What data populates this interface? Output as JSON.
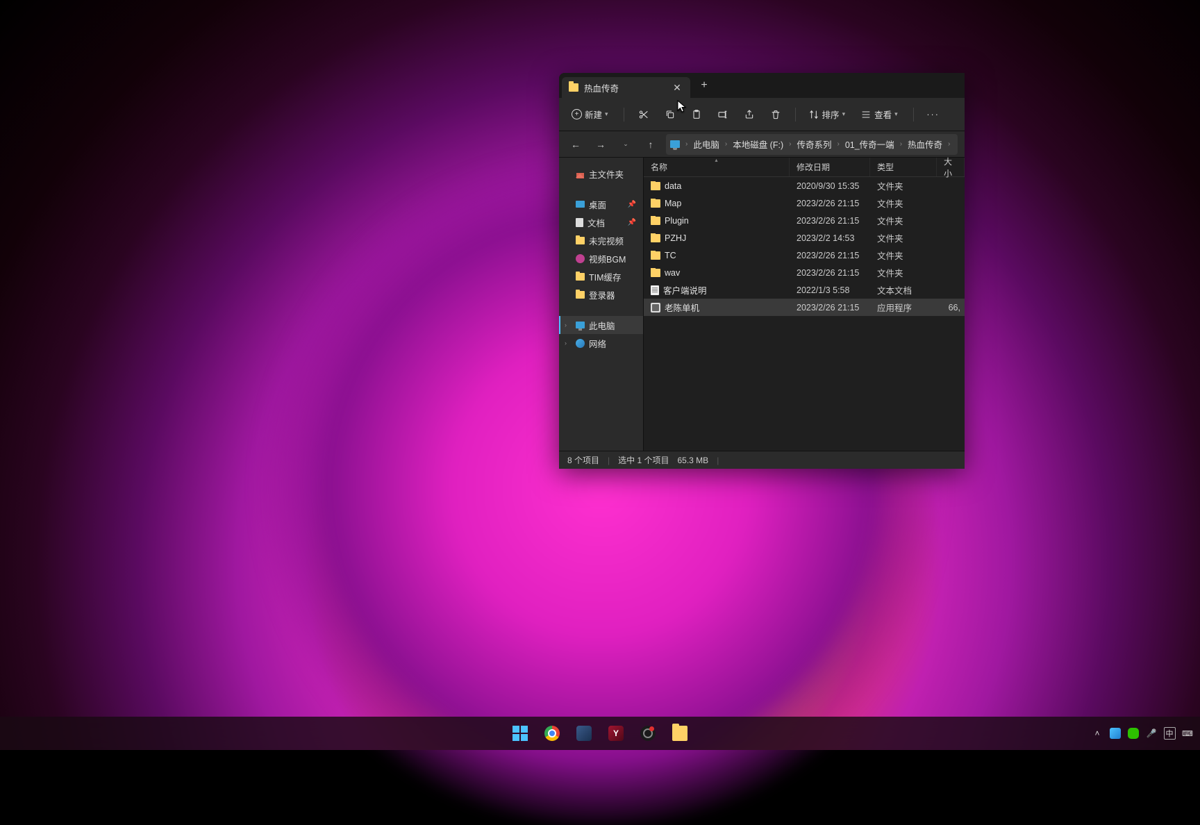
{
  "tab": {
    "title": "热血传奇"
  },
  "toolbar": {
    "new_label": "新建",
    "sort_label": "排序",
    "view_label": "查看"
  },
  "breadcrumb": [
    "此电脑",
    "本地磁盘 (F:)",
    "传奇系列",
    "01_传奇一端",
    "热血传奇"
  ],
  "sidebar": {
    "home": "主文件夹",
    "quick": [
      {
        "label": "桌面",
        "icon": "desktop",
        "pinned": true
      },
      {
        "label": "文档",
        "icon": "doc",
        "pinned": true
      },
      {
        "label": "未完视频",
        "icon": "folder",
        "pinned": false
      },
      {
        "label": "视频BGM",
        "icon": "music",
        "pinned": false
      },
      {
        "label": "TIM缓存",
        "icon": "folder",
        "pinned": false
      },
      {
        "label": "登录器",
        "icon": "folder",
        "pinned": false
      }
    ],
    "thispc": "此电脑",
    "network": "网络"
  },
  "columns": {
    "name": "名称",
    "date": "修改日期",
    "type": "类型",
    "size": "大小"
  },
  "files": [
    {
      "name": "data",
      "date": "2020/9/30 15:35",
      "type": "文件夹",
      "size": "",
      "icon": "folder",
      "selected": false
    },
    {
      "name": "Map",
      "date": "2023/2/26 21:15",
      "type": "文件夹",
      "size": "",
      "icon": "folder",
      "selected": false
    },
    {
      "name": "Plugin",
      "date": "2023/2/26 21:15",
      "type": "文件夹",
      "size": "",
      "icon": "folder",
      "selected": false
    },
    {
      "name": "PZHJ",
      "date": "2023/2/2 14:53",
      "type": "文件夹",
      "size": "",
      "icon": "folder",
      "selected": false
    },
    {
      "name": "TC",
      "date": "2023/2/26 21:15",
      "type": "文件夹",
      "size": "",
      "icon": "folder",
      "selected": false
    },
    {
      "name": "wav",
      "date": "2023/2/26 21:15",
      "type": "文件夹",
      "size": "",
      "icon": "folder",
      "selected": false
    },
    {
      "name": "客户端说明",
      "date": "2022/1/3 5:58",
      "type": "文本文档",
      "size": "",
      "icon": "txt",
      "selected": false
    },
    {
      "name": "老陈单机",
      "date": "2023/2/26 21:15",
      "type": "应用程序",
      "size": "66,",
      "icon": "exe",
      "selected": true
    }
  ],
  "status": {
    "count": "8 个项目",
    "selected": "选中 1 个项目",
    "size": "65.3 MB"
  }
}
